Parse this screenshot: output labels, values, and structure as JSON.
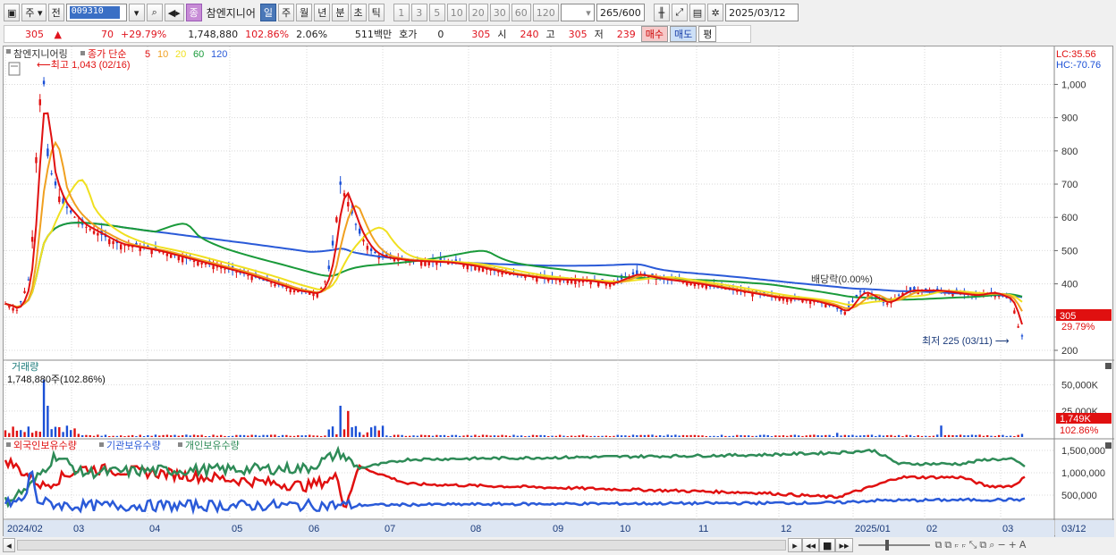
{
  "toolbar": {
    "market": "주",
    "type": "전",
    "code": "009310",
    "stock_name": "참엔지니어",
    "name_badge": "종",
    "periods": [
      "일",
      "주",
      "월",
      "년",
      "분",
      "초",
      "틱"
    ],
    "active_period": "일",
    "intervals": [
      "1",
      "3",
      "5",
      "10",
      "20",
      "30",
      "60",
      "120"
    ],
    "count": "265",
    "count_total": "/600",
    "date": "2025/03/12"
  },
  "quote": {
    "price": "305",
    "change": "70",
    "change_pct": "+29.79%",
    "volume": "1,748,880",
    "volume_ratio": "102.86%",
    "turnover": "2.06%",
    "amount": "511백만",
    "ask_label": "호가",
    "ask_value": "0",
    "current": "305",
    "open_label": "시",
    "open": "240",
    "high_label": "고",
    "high": "305",
    "low_label": "저",
    "low": "239",
    "buy": "매수",
    "sell": "매도",
    "eval": "평"
  },
  "price_panel": {
    "title": "참엔지니어링",
    "legend_label": "종가 단순",
    "ma_periods": [
      "5",
      "10",
      "20",
      "60",
      "120"
    ],
    "ma_colors": [
      "#e01010",
      "#f0a020",
      "#f0e020",
      "#1a9a3a",
      "#2a5ad8"
    ],
    "high_note": "최고 1,043 (02/16)",
    "low_note": "최저 225 (03/11)",
    "ex_right_note": "배당락(0.00%)",
    "lc": "LC:35.56",
    "hc": "HC:-70.76",
    "price_tag": "305",
    "pct_tag": "29.79%",
    "y_ticks": [
      "1,000",
      "900",
      "800",
      "700",
      "600",
      "500",
      "400",
      "300",
      "200"
    ]
  },
  "volume_panel": {
    "title": "거래량",
    "summary": "1,748,880주(102.86%)",
    "y_ticks": [
      "50,000K",
      "25,000K"
    ],
    "tag": "1,749K",
    "tag_pct": "102.86%"
  },
  "holding_panel": {
    "series_labels": [
      "외국인보유수량",
      "기관보유수량",
      "개인보유수량"
    ],
    "series_colors": [
      "#e01010",
      "#2a5ad8",
      "#2e8b57"
    ],
    "y_ticks": [
      "1,500,000",
      "1,000,000",
      "500,000"
    ]
  },
  "x_axis": {
    "labels": [
      "2024/02",
      "03",
      "04",
      "05",
      "06",
      "07",
      "08",
      "09",
      "10",
      "11",
      "12",
      "2025/01",
      "02",
      "03"
    ],
    "right_label": "03/12"
  }
}
